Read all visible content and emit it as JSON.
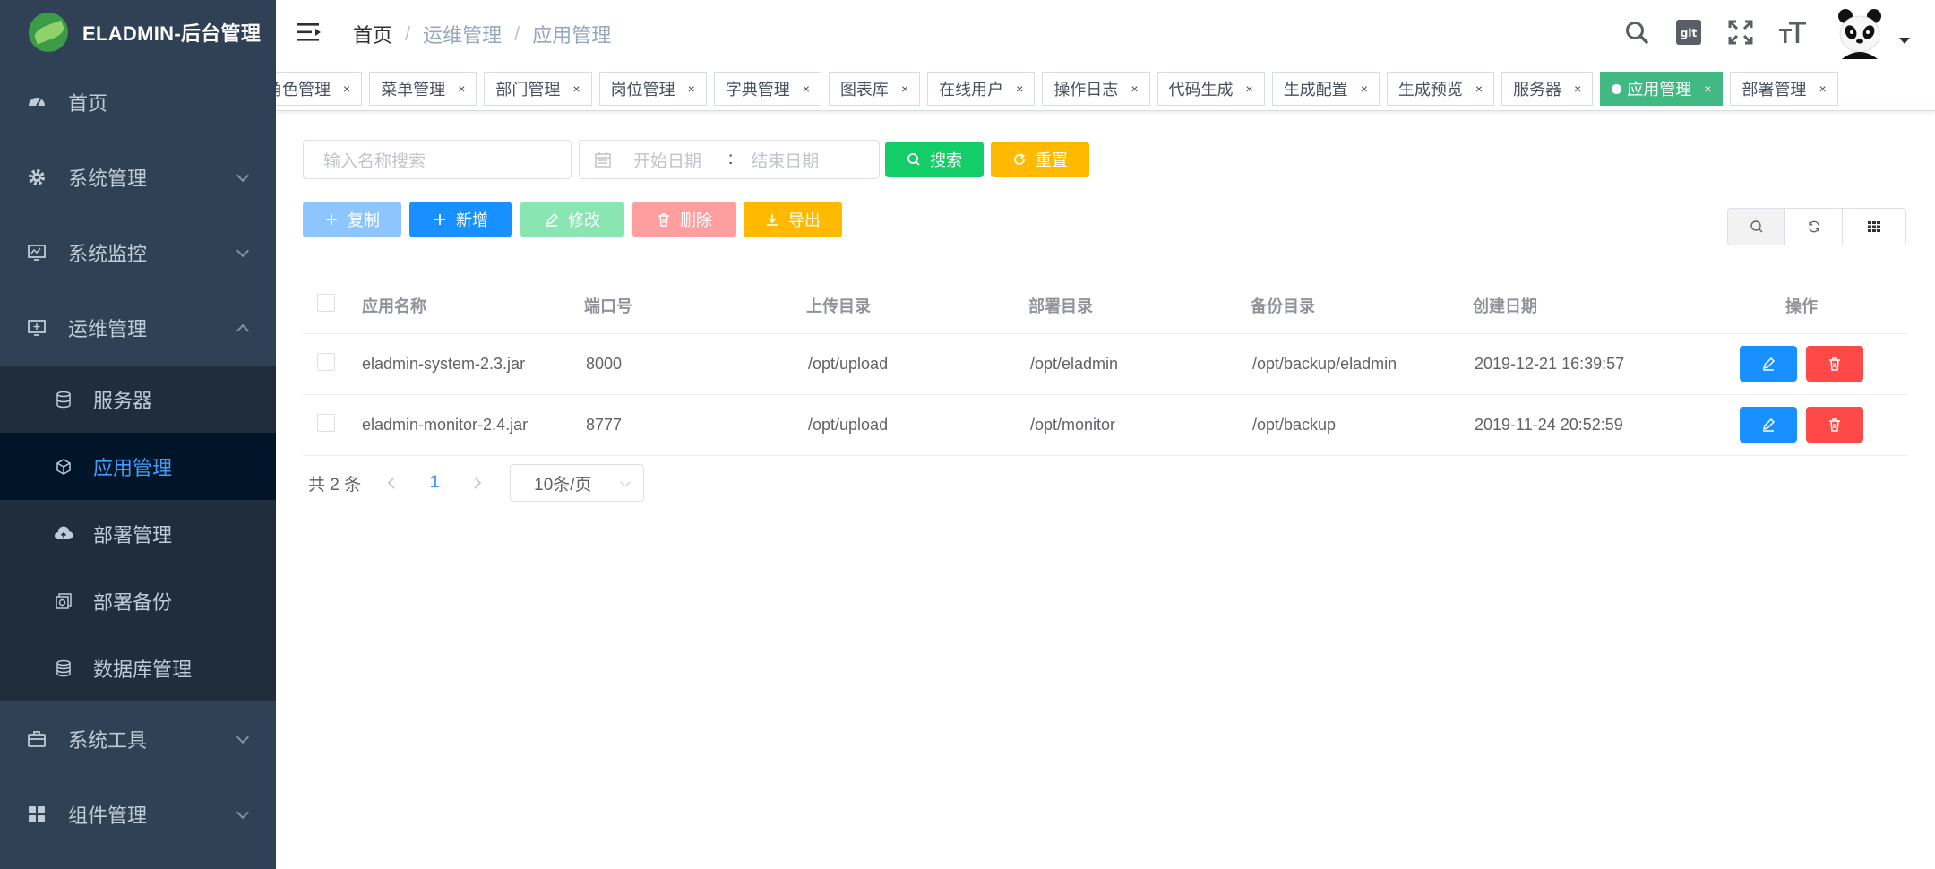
{
  "app": {
    "title": "ELADMIN-后台管理"
  },
  "sidebar": {
    "items": [
      {
        "label": "首页",
        "icon": "dashboard-icon"
      },
      {
        "label": "系统管理",
        "icon": "gear-icon"
      },
      {
        "label": "系统监控",
        "icon": "monitor-icon"
      },
      {
        "label": "运维管理",
        "icon": "devops-icon"
      }
    ],
    "subitems": [
      {
        "label": "服务器",
        "icon": "server-icon"
      },
      {
        "label": "应用管理",
        "icon": "app-icon"
      },
      {
        "label": "部署管理",
        "icon": "cloud-upload-icon"
      },
      {
        "label": "部署备份",
        "icon": "backup-icon"
      },
      {
        "label": "数据库管理",
        "icon": "database-icon"
      }
    ],
    "bottom": [
      {
        "label": "系统工具",
        "icon": "toolbox-icon"
      },
      {
        "label": "组件管理",
        "icon": "grid-icon"
      }
    ]
  },
  "breadcrumb": {
    "home": "首页",
    "level1": "运维管理",
    "level2": "应用管理"
  },
  "tags": [
    {
      "label": "角色管理",
      "active": false
    },
    {
      "label": "菜单管理",
      "active": false
    },
    {
      "label": "部门管理",
      "active": false
    },
    {
      "label": "岗位管理",
      "active": false
    },
    {
      "label": "字典管理",
      "active": false
    },
    {
      "label": "图表库",
      "active": false
    },
    {
      "label": "在线用户",
      "active": false
    },
    {
      "label": "操作日志",
      "active": false
    },
    {
      "label": "代码生成",
      "active": false
    },
    {
      "label": "生成配置",
      "active": false
    },
    {
      "label": "生成预览",
      "active": false
    },
    {
      "label": "服务器",
      "active": false
    },
    {
      "label": "应用管理",
      "active": true
    },
    {
      "label": "部署管理",
      "active": false
    }
  ],
  "tag_close": "×",
  "search": {
    "name_placeholder": "输入名称搜索",
    "start_placeholder": "开始日期",
    "range_sep": ":",
    "end_placeholder": "结束日期",
    "search_label": "搜索",
    "reset_label": "重置"
  },
  "toolbar": {
    "copy": "复制",
    "add": "新增",
    "edit": "修改",
    "delete": "删除",
    "export": "导出"
  },
  "table": {
    "headers": [
      "应用名称",
      "端口号",
      "上传目录",
      "部署目录",
      "备份目录",
      "创建日期",
      "操作"
    ],
    "rows": [
      {
        "name": "eladmin-system-2.3.jar",
        "port": "8000",
        "upload": "/opt/upload",
        "deploy": "/opt/eladmin",
        "backup": "/opt/backup/eladmin",
        "created": "2019-12-21 16:39:57"
      },
      {
        "name": "eladmin-monitor-2.4.jar",
        "port": "8777",
        "upload": "/opt/upload",
        "deploy": "/opt/monitor",
        "backup": "/opt/backup",
        "created": "2019-11-24 20:52:59"
      }
    ]
  },
  "pagination": {
    "total": "共 2 条",
    "page": "1",
    "page_size": "10条/页"
  },
  "colors": {
    "sidebar_bg": "#304156",
    "active_tag": "#42b983",
    "primary": "#1890ff",
    "danger": "#ff4949",
    "success": "#13ce66",
    "warning": "#ffba00"
  }
}
